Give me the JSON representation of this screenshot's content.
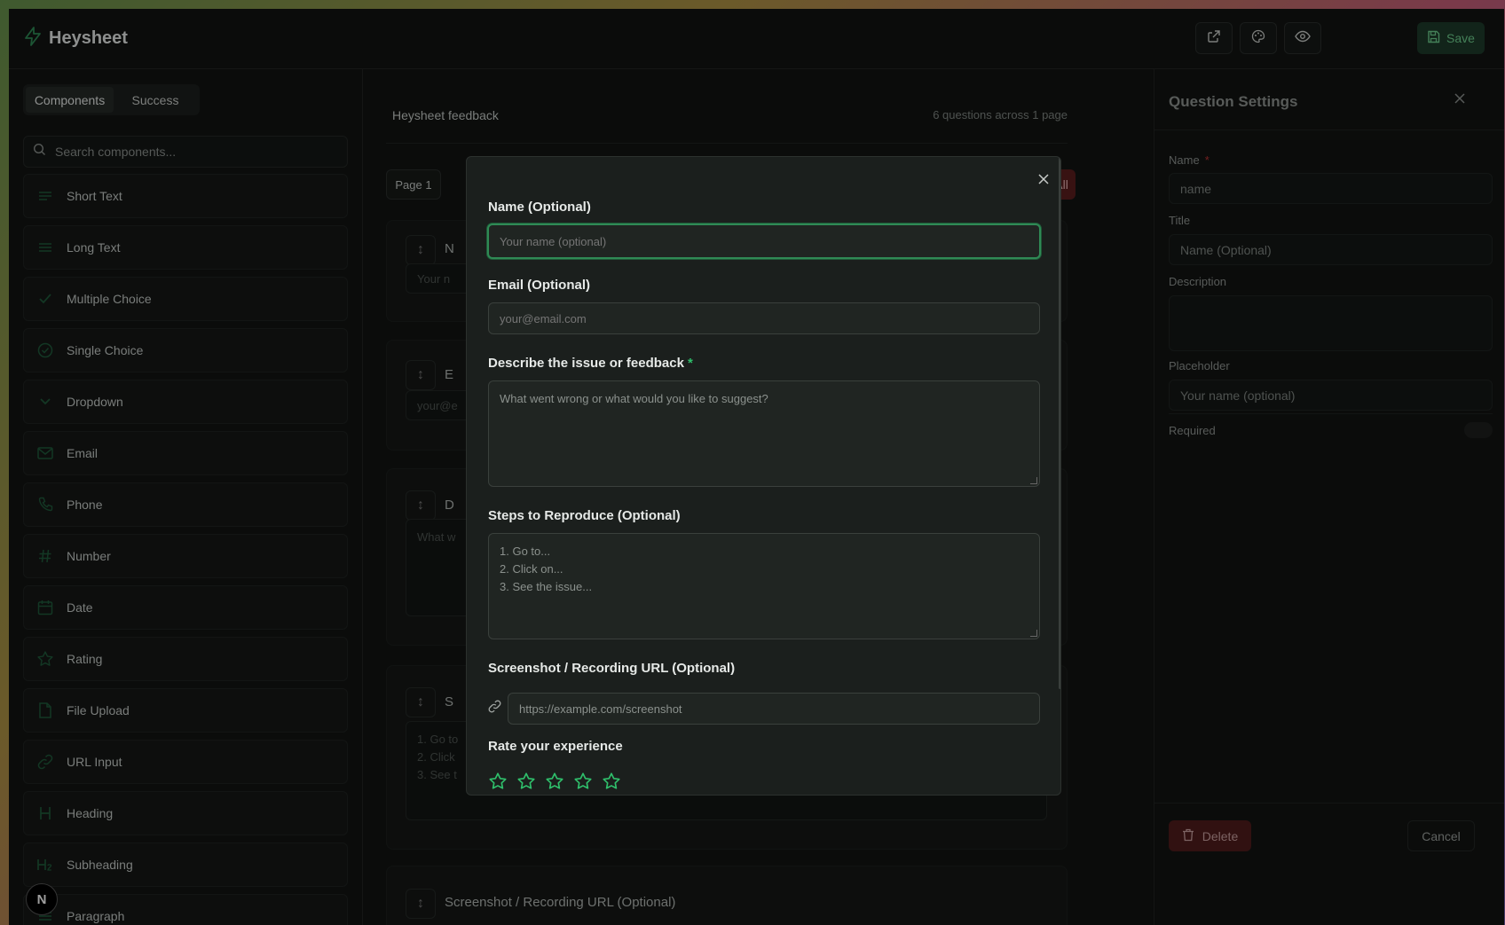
{
  "app": {
    "name": "Heysheet"
  },
  "header": {
    "save_label": "Save",
    "icons": [
      "external-link-icon",
      "palette-icon",
      "eye-icon",
      "save-icon"
    ]
  },
  "sidebar": {
    "tabs": [
      {
        "label": "Components",
        "active": true
      },
      {
        "label": "Success",
        "active": false
      }
    ],
    "search_placeholder": "Search components...",
    "components": [
      {
        "label": "Short Text",
        "icon": "short-text-icon"
      },
      {
        "label": "Long Text",
        "icon": "long-text-icon"
      },
      {
        "label": "Multiple Choice",
        "icon": "check-icon"
      },
      {
        "label": "Single Choice",
        "icon": "circle-check-icon"
      },
      {
        "label": "Dropdown",
        "icon": "chevron-down-icon"
      },
      {
        "label": "Email",
        "icon": "mail-icon"
      },
      {
        "label": "Phone",
        "icon": "phone-icon"
      },
      {
        "label": "Number",
        "icon": "hash-icon"
      },
      {
        "label": "Date",
        "icon": "calendar-icon"
      },
      {
        "label": "Rating",
        "icon": "star-icon"
      },
      {
        "label": "File Upload",
        "icon": "file-icon"
      },
      {
        "label": "URL Input",
        "icon": "link-icon"
      },
      {
        "label": "Heading",
        "icon": "heading-icon"
      },
      {
        "label": "Subheading",
        "icon": "subheading-icon"
      },
      {
        "label": "Paragraph",
        "icon": "paragraph-icon"
      }
    ],
    "badge": "N"
  },
  "center": {
    "form_title": "Heysheet feedback",
    "question_count": "6 questions across 1 page",
    "page_label": "Page 1",
    "clear_all_label": "Clear All",
    "questions": [
      {
        "title": "N",
        "placeholder": "Your n"
      },
      {
        "title": "E",
        "placeholder": "your@e"
      },
      {
        "title": "D",
        "placeholder": "What w"
      },
      {
        "title": "S",
        "placeholder": "1. Go to\n2. Click\n3. See t"
      },
      {
        "title": "Screenshot / Recording URL (Optional)",
        "placeholder": ""
      }
    ]
  },
  "modal": {
    "fields": [
      {
        "label": "Name (Optional)",
        "placeholder": "Your name (optional)",
        "required": false
      },
      {
        "label": "Email (Optional)",
        "placeholder": "your@email.com",
        "required": false
      },
      {
        "label": "Describe the issue or feedback",
        "placeholder": "What went wrong or what would you like to suggest?",
        "required": true
      },
      {
        "label": "Steps to Reproduce (Optional)",
        "placeholder": "1. Go to...\n2. Click on...\n3. See the issue...",
        "required": false
      },
      {
        "label": "Screenshot / Recording URL (Optional)",
        "placeholder": "https://example.com/screenshot",
        "required": false
      },
      {
        "label": "Rate your experience",
        "rating_max": 5,
        "rating_value": 0
      }
    ],
    "required_mark": "*"
  },
  "settings": {
    "title": "Question Settings",
    "name_label": "Name",
    "required_mark": "*",
    "name_value": "name",
    "title_label": "Title",
    "title_value": "Name (Optional)",
    "description_label": "Description",
    "description_value": "",
    "placeholder_label": "Placeholder",
    "placeholder_value": "Your name (optional)",
    "required_label": "Required",
    "required_on": false,
    "delete_label": "Delete",
    "cancel_label": "Cancel"
  },
  "colors": {
    "accent": "#2fbf6b",
    "danger": "#5b1e1e",
    "background": "#121413"
  }
}
